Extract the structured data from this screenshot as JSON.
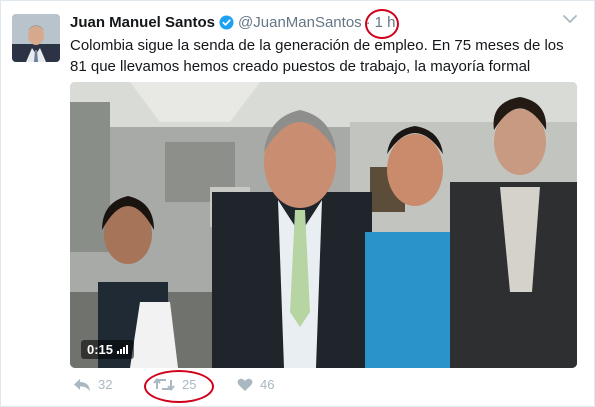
{
  "user": {
    "name": "Juan Manuel Santos",
    "handle": "@JuanManSantos",
    "time": "1 h",
    "verified_color": "#1da1f2"
  },
  "tweet": {
    "text": "Colombia sigue la senda de la generación de empleo. En 75 meses de los 81 que llevamos hemos creado puestos de trabajo, la mayoría formal"
  },
  "media": {
    "duration": "0:15"
  },
  "actions": {
    "reply_count": "32",
    "retweet_count": "25",
    "like_count": "46"
  },
  "annotation_color": "#d0021b"
}
